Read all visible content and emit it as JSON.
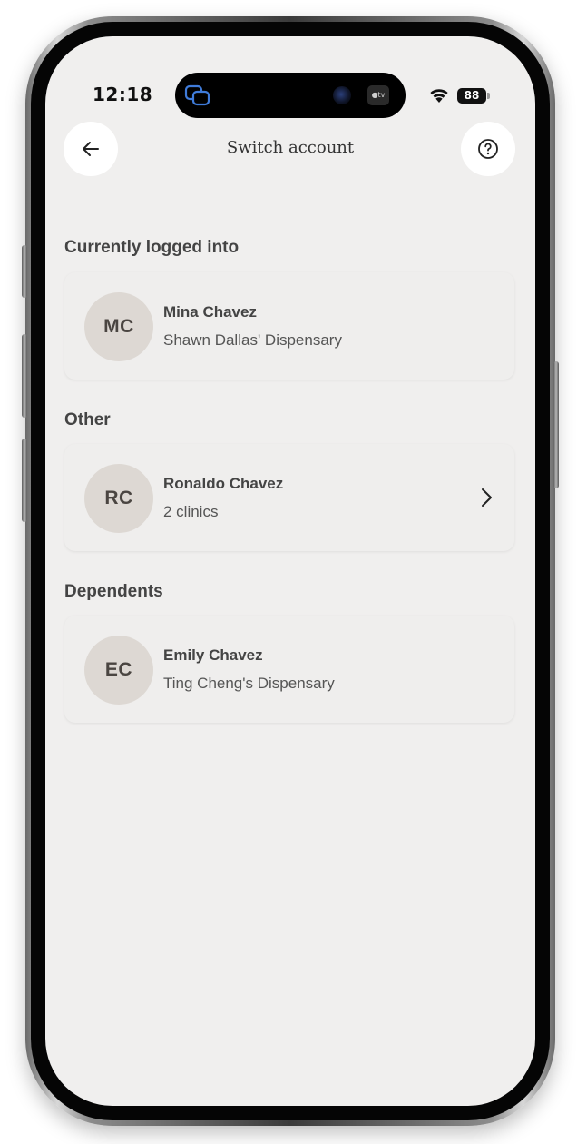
{
  "status_bar": {
    "time": "12:18",
    "battery": "88",
    "appletv_label": "●tv",
    "icons": [
      "screen-mirror-icon",
      "camera-icon",
      "appletv-icon",
      "wifi-icon",
      "battery-icon"
    ]
  },
  "header": {
    "title": "Switch account",
    "back_icon": "arrow-left-icon",
    "help_icon": "question-circle-icon"
  },
  "current": {
    "section_title": "Currently logged into",
    "account": {
      "initials": "MC",
      "name": "Mina Chavez",
      "subtitle": "Shawn Dallas' Dispensary"
    }
  },
  "other": {
    "section_title": "Other",
    "account": {
      "initials": "RC",
      "name": "Ronaldo Chavez",
      "subtitle": "2 clinics",
      "chevron_icon": "chevron-right-icon"
    }
  },
  "dependents": {
    "section_title": "Dependents",
    "account": {
      "initials": "EC",
      "name": "Emily Chavez",
      "subtitle": "Ting Cheng's Dispensary"
    }
  },
  "colors": {
    "screen_bg": "#f0efee",
    "avatar_bg": "#ddd8d3",
    "text_dark": "#444444",
    "button_bg": "#ffffff",
    "island_accent": "#3f7bd9"
  }
}
